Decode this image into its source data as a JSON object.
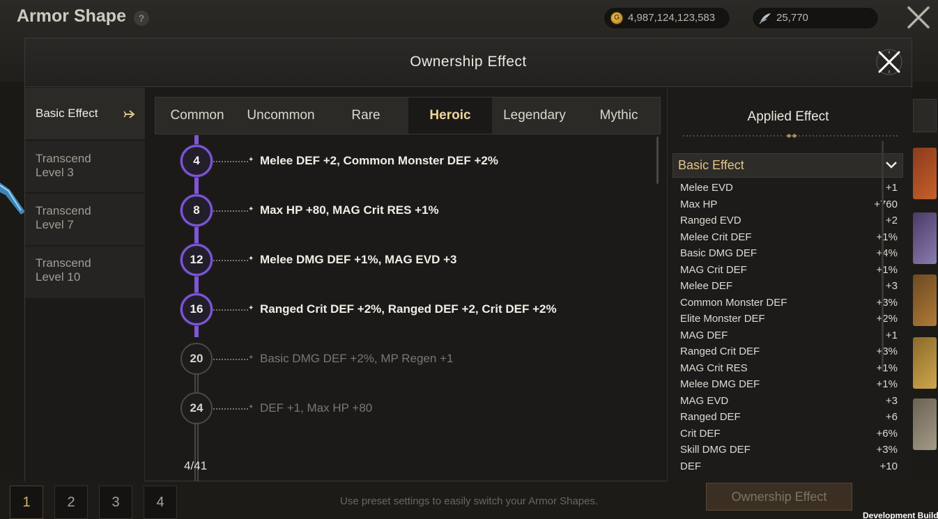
{
  "page": {
    "title": "Armor Shape",
    "help_icon": "?",
    "gold": "4,987,124,123,583",
    "feathers": "25,770",
    "coin_glyph": "G"
  },
  "modal": {
    "title": "Ownership Effect",
    "left_menu": [
      {
        "label": "Basic Effect",
        "active": true
      },
      {
        "label": "Transcend\nLevel 3",
        "active": false
      },
      {
        "label": "Transcend\nLevel 7",
        "active": false
      },
      {
        "label": "Transcend\nLevel 10",
        "active": false
      }
    ],
    "tabs": [
      "Common",
      "Uncommon",
      "Rare",
      "Heroic",
      "Legendary",
      "Mythic"
    ],
    "active_tab": "Heroic",
    "milestones": [
      {
        "level": "4",
        "reward": "Melee DEF +2, Common Monster DEF +2%",
        "unlocked": true
      },
      {
        "level": "8",
        "reward": "Max HP +80, MAG Crit RES +1%",
        "unlocked": true
      },
      {
        "level": "12",
        "reward": "Melee DMG DEF +1%, MAG EVD +3",
        "unlocked": true
      },
      {
        "level": "16",
        "reward": "Ranged Crit DEF +2%, Ranged DEF +2, Crit DEF +2%",
        "unlocked": true
      },
      {
        "level": "20",
        "reward": "Basic DMG DEF +2%, MP Regen +1",
        "unlocked": false
      },
      {
        "level": "24",
        "reward": "DEF +1, Max HP +80",
        "unlocked": false
      }
    ],
    "progress": "4/41",
    "applied_effect": {
      "title": "Applied Effect",
      "section": "Basic Effect",
      "rows": [
        {
          "name": "Melee EVD",
          "value": "+1"
        },
        {
          "name": "Max HP",
          "value": "+760"
        },
        {
          "name": "Ranged EVD",
          "value": "+2"
        },
        {
          "name": "Melee Crit DEF",
          "value": "+1%"
        },
        {
          "name": "Basic DMG DEF",
          "value": "+4%"
        },
        {
          "name": "MAG Crit DEF",
          "value": "+1%"
        },
        {
          "name": "Melee DEF",
          "value": "+3"
        },
        {
          "name": "Common Monster DEF",
          "value": "+3%"
        },
        {
          "name": "Elite Monster DEF",
          "value": "+2%"
        },
        {
          "name": "MAG DEF",
          "value": "+1"
        },
        {
          "name": "Ranged Crit DEF",
          "value": "+3%"
        },
        {
          "name": "MAG Crit RES",
          "value": "+1%"
        },
        {
          "name": "Melee DMG DEF",
          "value": "+1%"
        },
        {
          "name": "MAG EVD",
          "value": "+3"
        },
        {
          "name": "Ranged DEF",
          "value": "+6"
        },
        {
          "name": "Crit DEF",
          "value": "+6%"
        },
        {
          "name": "Skill DMG DEF",
          "value": "+3%"
        },
        {
          "name": "DEF",
          "value": "+10"
        }
      ]
    }
  },
  "bottom": {
    "presets": [
      "1",
      "2",
      "3",
      "4"
    ],
    "active_preset": "1",
    "hint": "Use preset settings to easily switch your Armor Shapes.",
    "ownership_button": "Ownership Effect",
    "dev_build": "Development Build"
  },
  "colors": {
    "accent_purple": "#7f55d8",
    "gold_text": "#e2c586",
    "active_tab_text": "#f0d49a"
  },
  "icons": [
    "help-icon",
    "gold-coin-icon",
    "feather-icon",
    "close-icon",
    "arrow-right-icon",
    "chevron-down-icon",
    "star-icon"
  ]
}
